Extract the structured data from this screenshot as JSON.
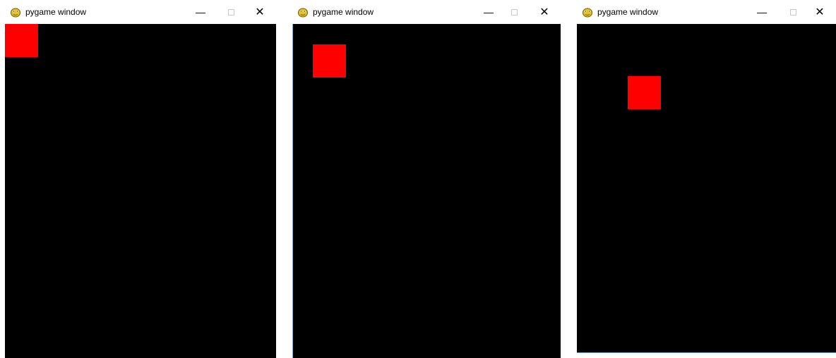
{
  "windows": [
    {
      "title": "pygame window",
      "controls": {
        "minimize": "—",
        "maximize": "□",
        "close": "✕"
      },
      "canvas_color": "#000000",
      "sprite_color": "#ff0000"
    },
    {
      "title": "pygame window",
      "controls": {
        "minimize": "—",
        "maximize": "□",
        "close": "✕"
      },
      "canvas_color": "#000000",
      "sprite_color": "#ff0000"
    },
    {
      "title": "pygame window",
      "controls": {
        "minimize": "—",
        "maximize": "□",
        "close": "✕"
      },
      "canvas_color": "#000000",
      "sprite_color": "#ff0000"
    }
  ],
  "app_icon": "pygame-snake-icon"
}
